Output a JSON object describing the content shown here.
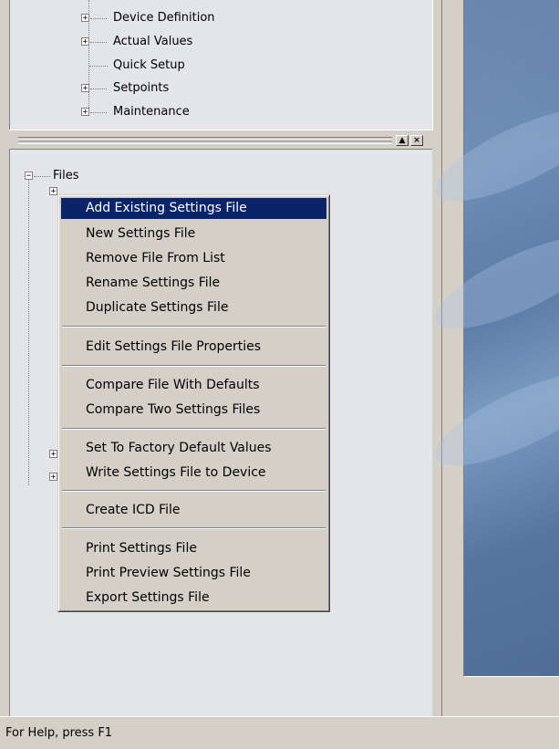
{
  "top_tree": {
    "items": [
      {
        "label": "Device Definition",
        "expandable": true
      },
      {
        "label": "Actual Values",
        "expandable": true
      },
      {
        "label": "Quick Setup",
        "expandable": false
      },
      {
        "label": "Setpoints",
        "expandable": true
      },
      {
        "label": "Maintenance",
        "expandable": true
      }
    ]
  },
  "pane_controls": {
    "maximize_icon": "▲",
    "close_icon": "×"
  },
  "files_tree": {
    "root_label": "Files",
    "root_expander": "−",
    "child_expander": "+"
  },
  "context_menu": {
    "items": [
      {
        "label": "Add Existing Settings File",
        "selected": true
      },
      {
        "label": "New Settings File"
      },
      {
        "label": "Remove File From List"
      },
      {
        "label": "Rename Settings File"
      },
      {
        "label": "Duplicate Settings File"
      },
      {
        "label": "Edit Settings File Properties"
      },
      {
        "label": "Compare File With Defaults"
      },
      {
        "label": "Compare Two Settings Files"
      },
      {
        "label": "Set To Factory Default Values"
      },
      {
        "label": "Write Settings File to Device"
      },
      {
        "label": "Create ICD File"
      },
      {
        "label": "Print Settings File"
      },
      {
        "label": "Print Preview Settings File"
      },
      {
        "label": "Export Settings File"
      }
    ]
  },
  "status_bar": {
    "text": "For Help, press F1"
  },
  "colors": {
    "menu_highlight": "#0a246a",
    "pane_background": "#e3e5e8",
    "chrome": "#d4d0c8"
  }
}
